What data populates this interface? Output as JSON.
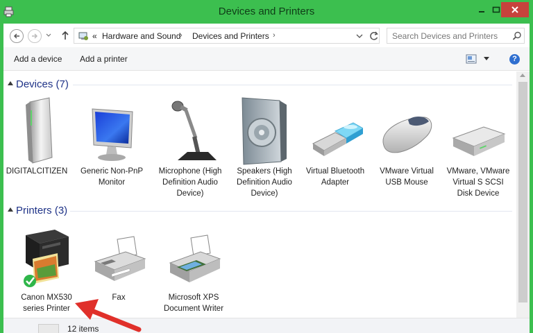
{
  "window": {
    "title": "Devices and Printers"
  },
  "address_bar": {
    "overflow_marker": "«",
    "breadcrumbs": [
      "Hardware and Sound",
      "Devices and Printers"
    ]
  },
  "search": {
    "placeholder": "Search Devices and Printers"
  },
  "command_bar": {
    "add_device": "Add a device",
    "add_printer": "Add a printer",
    "help": "?"
  },
  "groups": {
    "devices": {
      "title": "Devices (7)",
      "items": [
        {
          "label": "DIGITALCITIZEN",
          "icon": "computer-tower-icon"
        },
        {
          "label": "Generic Non-PnP Monitor",
          "icon": "monitor-icon"
        },
        {
          "label": "Microphone (High Definition Audio Device)",
          "icon": "microphone-icon"
        },
        {
          "label": "Speakers (High Definition Audio Device)",
          "icon": "speaker-icon"
        },
        {
          "label": "Virtual Bluetooth Adapter",
          "icon": "bluetooth-adapter-icon"
        },
        {
          "label": "VMware Virtual USB Mouse",
          "icon": "mouse-icon"
        },
        {
          "label": "VMware, VMware Virtual S SCSI Disk Device",
          "icon": "hard-disk-icon"
        }
      ]
    },
    "printers": {
      "title": "Printers (3)",
      "items": [
        {
          "label": "Canon MX530 series Printer",
          "icon": "printer-default-icon",
          "is_default": true
        },
        {
          "label": "Fax",
          "icon": "fax-icon"
        },
        {
          "label": "Microsoft XPS Document Writer",
          "icon": "printer-icon"
        }
      ]
    }
  },
  "status_bar": {
    "item_count": "12 items"
  },
  "colors": {
    "frame": "#3cbf4f",
    "close_button": "#c7433c",
    "group_title": "#1e3287",
    "annotation_arrow": "#e0302a",
    "default_check": "#2fb64a"
  }
}
